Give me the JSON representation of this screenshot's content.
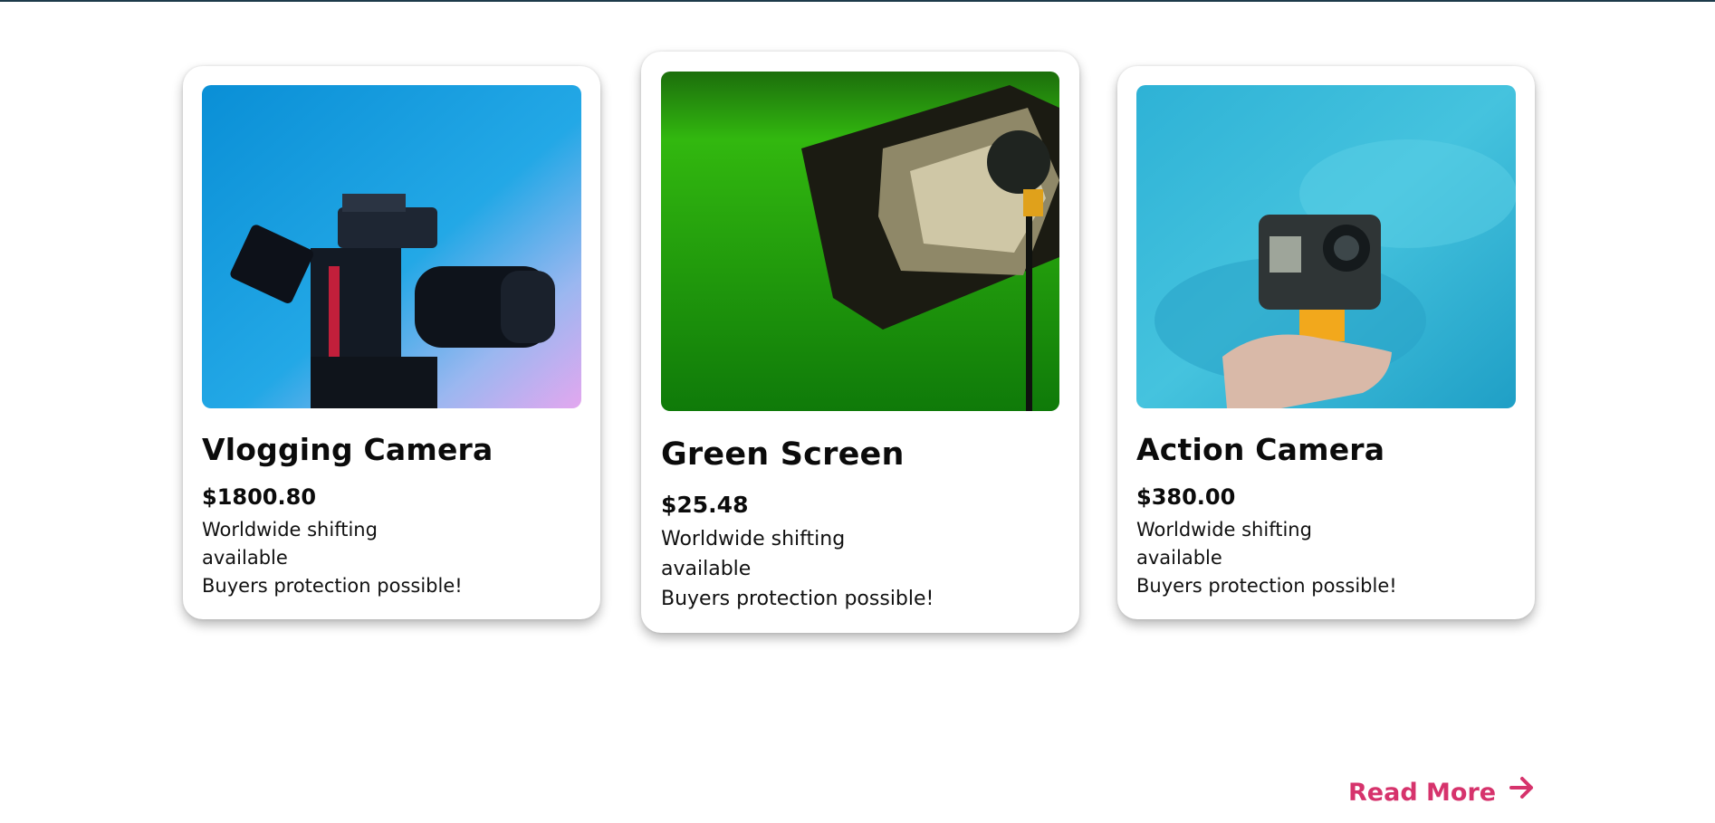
{
  "products": [
    {
      "title": "Vlogging Camera",
      "price": "$1800.80",
      "desc_line1": "Worldwide shifting",
      "desc_line2": "available",
      "desc_line3": "Buyers protection possible!"
    },
    {
      "title": "Green Screen",
      "price": "$25.48",
      "desc_line1": "Worldwide shifting",
      "desc_line2": "available",
      "desc_line3": "Buyers protection possible!"
    },
    {
      "title": "Action Camera",
      "price": "$380.00",
      "desc_line1": "Worldwide shifting",
      "desc_line2": "available",
      "desc_line3": "Buyers protection possible!"
    }
  ],
  "read_more": {
    "label": "Read More",
    "icon": "arrow-right-icon"
  },
  "colors": {
    "accent": "#d6336c",
    "top_border": "#1d3a4a"
  }
}
